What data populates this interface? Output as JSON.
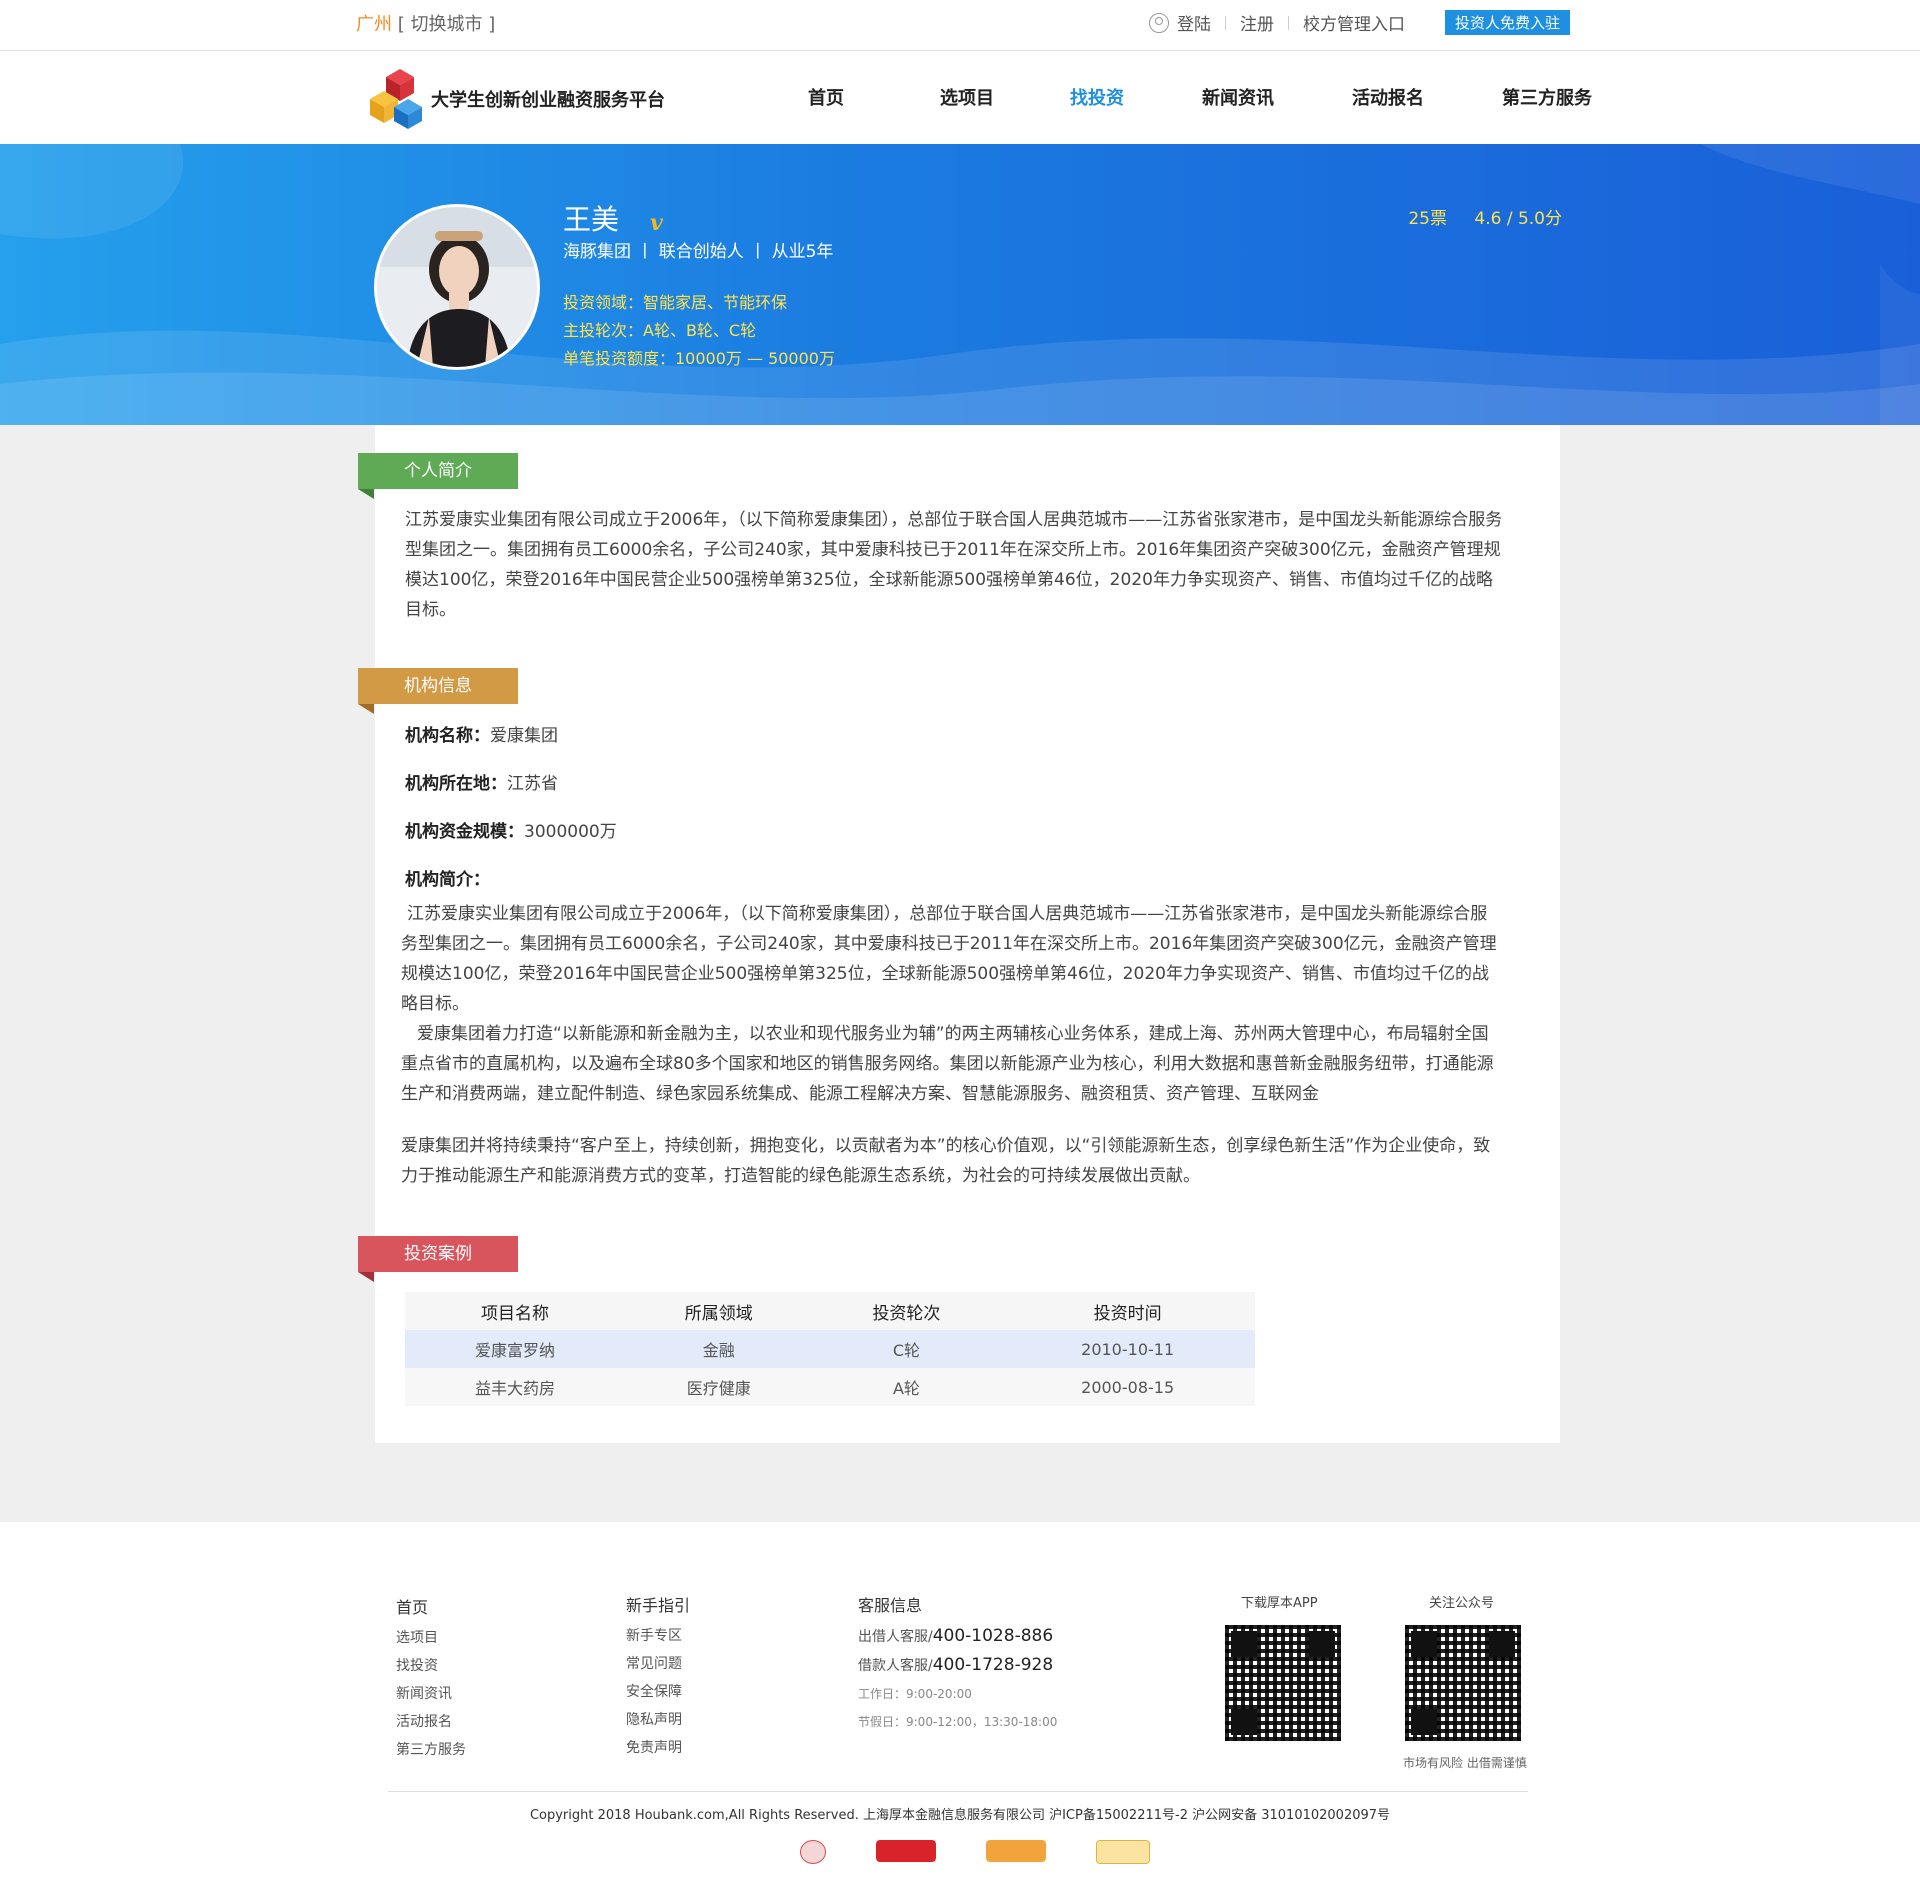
{
  "topbar": {
    "city": "广州",
    "switch_city": "[ 切换城市 ]",
    "login": "登陆",
    "register": "注册",
    "school_admin": "校方管理入口",
    "investor_cta": "投资人免费入驻"
  },
  "nav": {
    "brand": "大学生创新创业融资服务平台",
    "items": [
      "首页",
      "选项目",
      "找投资",
      "新闻资讯",
      "活动报名",
      "第三方服务"
    ],
    "active": "找投资"
  },
  "profile": {
    "name": "王美",
    "verified_mark": "v",
    "meta": "海豚集团 丨 联合创始人 丨 从业5年",
    "fields": "投资领域：智能家居、节能环保",
    "rounds": "主投轮次：A轮、B轮、C轮",
    "amount": "单笔投资额度：10000万 — 50000万",
    "votes": "25票",
    "score": "4.6 / 5.0分"
  },
  "sections": {
    "intro_tag": "个人简介",
    "intro_text": "江苏爱康实业集团有限公司成立于2006年，（以下简称爱康集团），总部位于联合国人居典范城市——江苏省张家港市，是中国龙头新能源综合服务型集团之一。集团拥有员工6000余名，子公司240家，其中爱康科技已于2011年在深交所上市。2016年集团资产突破300亿元，金融资产管理规模达100亿，荣登2016年中国民营企业500强榜单第325位，全球新能源500强榜单第46位，2020年力争实现资产、销售、市值均过千亿的战略目标。",
    "org_tag": "机构信息",
    "org_name_label": "机构名称：",
    "org_name": "爱康集团",
    "org_loc_label": "机构所在地：",
    "org_loc": "江苏省",
    "org_fund_label": "机构资金规模：",
    "org_fund": "3000000万",
    "org_intro_label": "机构简介：",
    "org_intro_p1": "江苏爱康实业集团有限公司成立于2006年，（以下简称爱康集团），总部位于联合国人居典范城市——江苏省张家港市，是中国龙头新能源综合服务型集团之一。集团拥有员工6000余名，子公司240家，其中爱康科技已于2011年在深交所上市。2016年集团资产突破300亿元，金融资产管理规模达100亿，荣登2016年中国民营企业500强榜单第325位，全球新能源500强榜单第46位，2020年力争实现资产、销售、市值均过千亿的战略目标。",
    "org_intro_p2": "爱康集团着力打造“以新能源和新金融为主，以农业和现代服务业为辅”的两主两辅核心业务体系，建成上海、苏州两大管理中心，布局辐射全国重点省市的直属机构，以及遍布全球80多个国家和地区的销售服务网络。集团以新能源产业为核心，利用大数据和惠普新金融服务纽带，打通能源生产和消费两端，建立配件制造、绿色家园系统集成、能源工程解决方案、智慧能源服务、融资租赁、资产管理、互联网金",
    "org_intro_p3": "爱康集团并将持续秉持“客户至上，持续创新，拥抱变化，以贡献者为本”的核心价值观，以“引领能源新生态，创享绿色新生活”作为企业使命，致力于推动能源生产和能源消费方式的变革，打造智能的绿色能源生态系统，为社会的可持续发展做出贡献。",
    "cases_tag": "投资案例"
  },
  "cases": {
    "headers": [
      "项目名称",
      "所属领域",
      "投资轮次",
      "投资时间"
    ],
    "rows": [
      [
        "爱康富罗纳",
        "金融",
        "C轮",
        "2010-10-11"
      ],
      [
        "益丰大药房",
        "医疗健康",
        "A轮",
        "2000-08-15"
      ]
    ]
  },
  "footer": {
    "col1": [
      "首页",
      "选项目",
      "找投资",
      "新闻资讯",
      "活动报名",
      "第三方服务"
    ],
    "col2_title": "新手指引",
    "col2": [
      "新手专区",
      "常见问题",
      "安全保障",
      "隐私声明",
      "免责声明"
    ],
    "col3_title": "客服信息",
    "lender_label": "出借人客服/",
    "lender_phone": "400-1028-886",
    "borrower_label": "借款人客服/",
    "borrower_phone": "400-1728-928",
    "workday": "工作日：9:00-20:00",
    "holiday": "节假日：9:00-12:00，13:30-18:00",
    "app_label": "下载厚本APP",
    "wechat_label": "关注公众号",
    "risk_note": "市场有风险 出借需谨慎",
    "copyright": "Copyright 2018 Houbank.com,All Rights Reserved.   上海厚本金融信息服务有限公司     沪ICP备15002211号-2     沪公网安备 31010102002097号"
  },
  "colors": {
    "accent": "#1f8fe0",
    "city": "#f28a1e",
    "banner_text": "#ffe24d",
    "tag_green": "#5fab55",
    "tag_gold": "#d39a45",
    "tag_red": "#d9555e"
  }
}
